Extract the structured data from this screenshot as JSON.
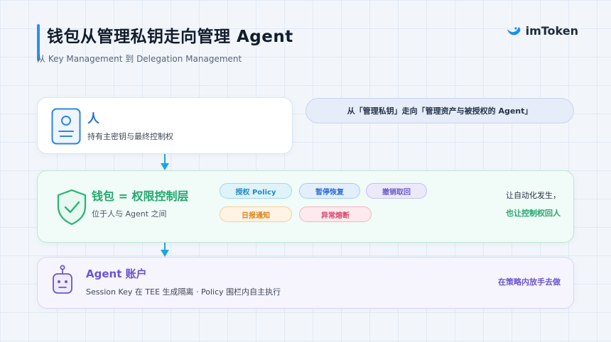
{
  "header": {
    "title": "钱包从管理私钥走向管理 Agent",
    "subtitle": "从 Key Management 到 Delegation Management",
    "logo_text": "imToken"
  },
  "person": {
    "title": "人",
    "desc": "持有主密钥与最终控制权",
    "icon": "id-card-icon"
  },
  "quote": "从「管理私钥」走向「管理资产与被授权的 Agent」",
  "wallet": {
    "title": "钱包 = 权限控制层",
    "desc": "位于人与 Agent 之间",
    "icon": "shield-check-icon",
    "chips": [
      "授权 Policy",
      "暂停恢复",
      "撤销取回",
      "日报通知",
      "异常熔断"
    ],
    "note_line1": "让自动化发生，",
    "note_line2": "也让控制权回人"
  },
  "agent": {
    "title": "Agent 账户",
    "desc": "Session Key 在 TEE 生成隔离 · Policy 围栏内自主执行",
    "icon": "robot-icon",
    "note": "在策略内放手去做"
  },
  "colors": {
    "accent_blue": "#2f8fe6",
    "wallet_green": "#22a86e",
    "agent_purple": "#6a55d0",
    "arrow": "#1aa6e0"
  }
}
